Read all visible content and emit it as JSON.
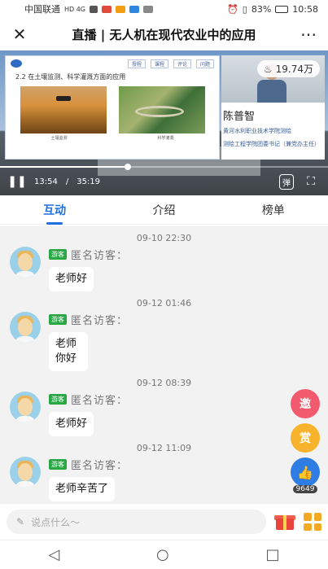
{
  "status_bar": {
    "carrier": "中国联通",
    "net": "HD 4G",
    "battery": "83%",
    "time": "10:58"
  },
  "header": {
    "close_icon": "close-icon",
    "title": "直播 | 无人机在现代农业中的应用",
    "more_icon": "more-icon"
  },
  "video": {
    "slide_heading": "2.2  在土壤监测、科学灌溉方面的应用",
    "slide_tabs": [
      "授程",
      "课程",
      "评论",
      "问题"
    ],
    "pic_captions": [
      "土壤监测",
      "科学灌溉"
    ],
    "viewers": "19.74万",
    "presenter_name": "陈普智",
    "presenter_desc": [
      "黄河水利职业技术学院测绘",
      "测绘工程学院团委书记（兼党办主任）"
    ],
    "current_time": "13:54",
    "total_time": "35:19",
    "progress": 0.39,
    "danmu_label": "弹"
  },
  "tabs": [
    {
      "label": "互动",
      "active": true
    },
    {
      "label": "介绍",
      "active": false
    },
    {
      "label": "榜单",
      "active": false
    }
  ],
  "messages": [
    {
      "time": "09-10 22:30",
      "badge": "游客",
      "name": "匿名访客：",
      "text": "老师好"
    },
    {
      "time": "09-12 01:46",
      "badge": "游客",
      "name": "匿名访客：",
      "text": "老师你好"
    },
    {
      "time": "09-12 08:39",
      "badge": "游客",
      "name": "匿名访客：",
      "text": "老师好"
    },
    {
      "time": "09-12 11:09",
      "badge": "游客",
      "name": "匿名访客：",
      "text": "老师辛苦了"
    }
  ],
  "float_buttons": {
    "invite": "邀",
    "reward": "赏",
    "like_count": "9649"
  },
  "input": {
    "placeholder": "说点什么～"
  },
  "colors": {
    "accent": "#1e6fe0",
    "guest_badge": "#28a745",
    "invite": "#f25a6e",
    "reward": "#f7b32b"
  }
}
